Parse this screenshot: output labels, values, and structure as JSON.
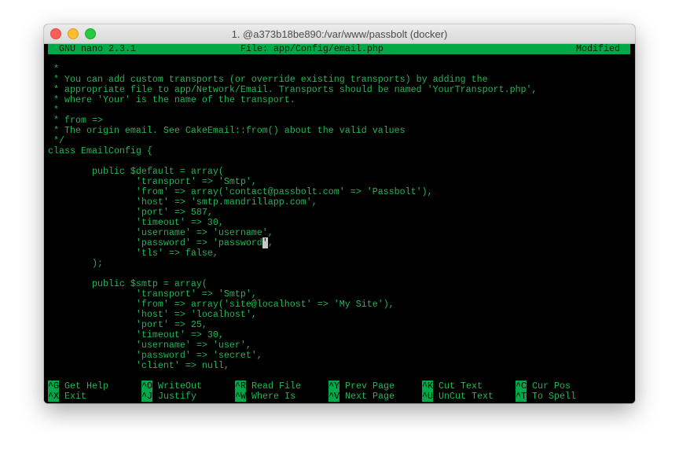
{
  "window": {
    "title": "1. @a373b18be890:/var/www/passbolt (docker)"
  },
  "colors": {
    "text": "#22b455",
    "bar": "#00a848",
    "background": "#000000"
  },
  "nano": {
    "version": "GNU nano 2.3.1",
    "file": "File: app/Config/email.php",
    "status": "Modified"
  },
  "lines": [
    "",
    " *",
    " * You can add custom transports (or override existing transports) by adding the",
    " * appropriate file to app/Network/Email. Transports should be named 'YourTransport.php',",
    " * where 'Your' is the name of the transport.",
    " *",
    " * from =>",
    " * The origin email. See CakeEmail::from() about the valid values",
    " */",
    "class EmailConfig {",
    "",
    "        public $default = array(",
    "                'transport' => 'Smtp',",
    "                'from' => array('contact@passbolt.com' => 'Passbolt'),",
    "                'host' => 'smtp.mandrillapp.com',",
    "                'port' => 587,",
    "                'timeout' => 30,",
    "                'username' => 'username',",
    {
      "before": "                'password' => 'password",
      "at": "'",
      "after": ","
    },
    "                'tls' => false,",
    "        );",
    "",
    "        public $smtp = array(",
    "                'transport' => 'Smtp',",
    "                'from' => array('site@localhost' => 'My Site'),",
    "                'host' => 'localhost',",
    "                'port' => 25,",
    "                'timeout' => 30,",
    "                'username' => 'user',",
    "                'password' => 'secret',",
    "                'client' => null,",
    ""
  ],
  "shortcuts": [
    {
      "key": "^G",
      "label": "Get Help"
    },
    {
      "key": "^O",
      "label": "WriteOut"
    },
    {
      "key": "^R",
      "label": "Read File"
    },
    {
      "key": "^Y",
      "label": "Prev Page"
    },
    {
      "key": "^K",
      "label": "Cut Text"
    },
    {
      "key": "^C",
      "label": "Cur Pos"
    },
    {
      "key": "^X",
      "label": "Exit"
    },
    {
      "key": "^J",
      "label": "Justify"
    },
    {
      "key": "^W",
      "label": "Where Is"
    },
    {
      "key": "^V",
      "label": "Next Page"
    },
    {
      "key": "^U",
      "label": "UnCut Text"
    },
    {
      "key": "^T",
      "label": "To Spell"
    }
  ]
}
